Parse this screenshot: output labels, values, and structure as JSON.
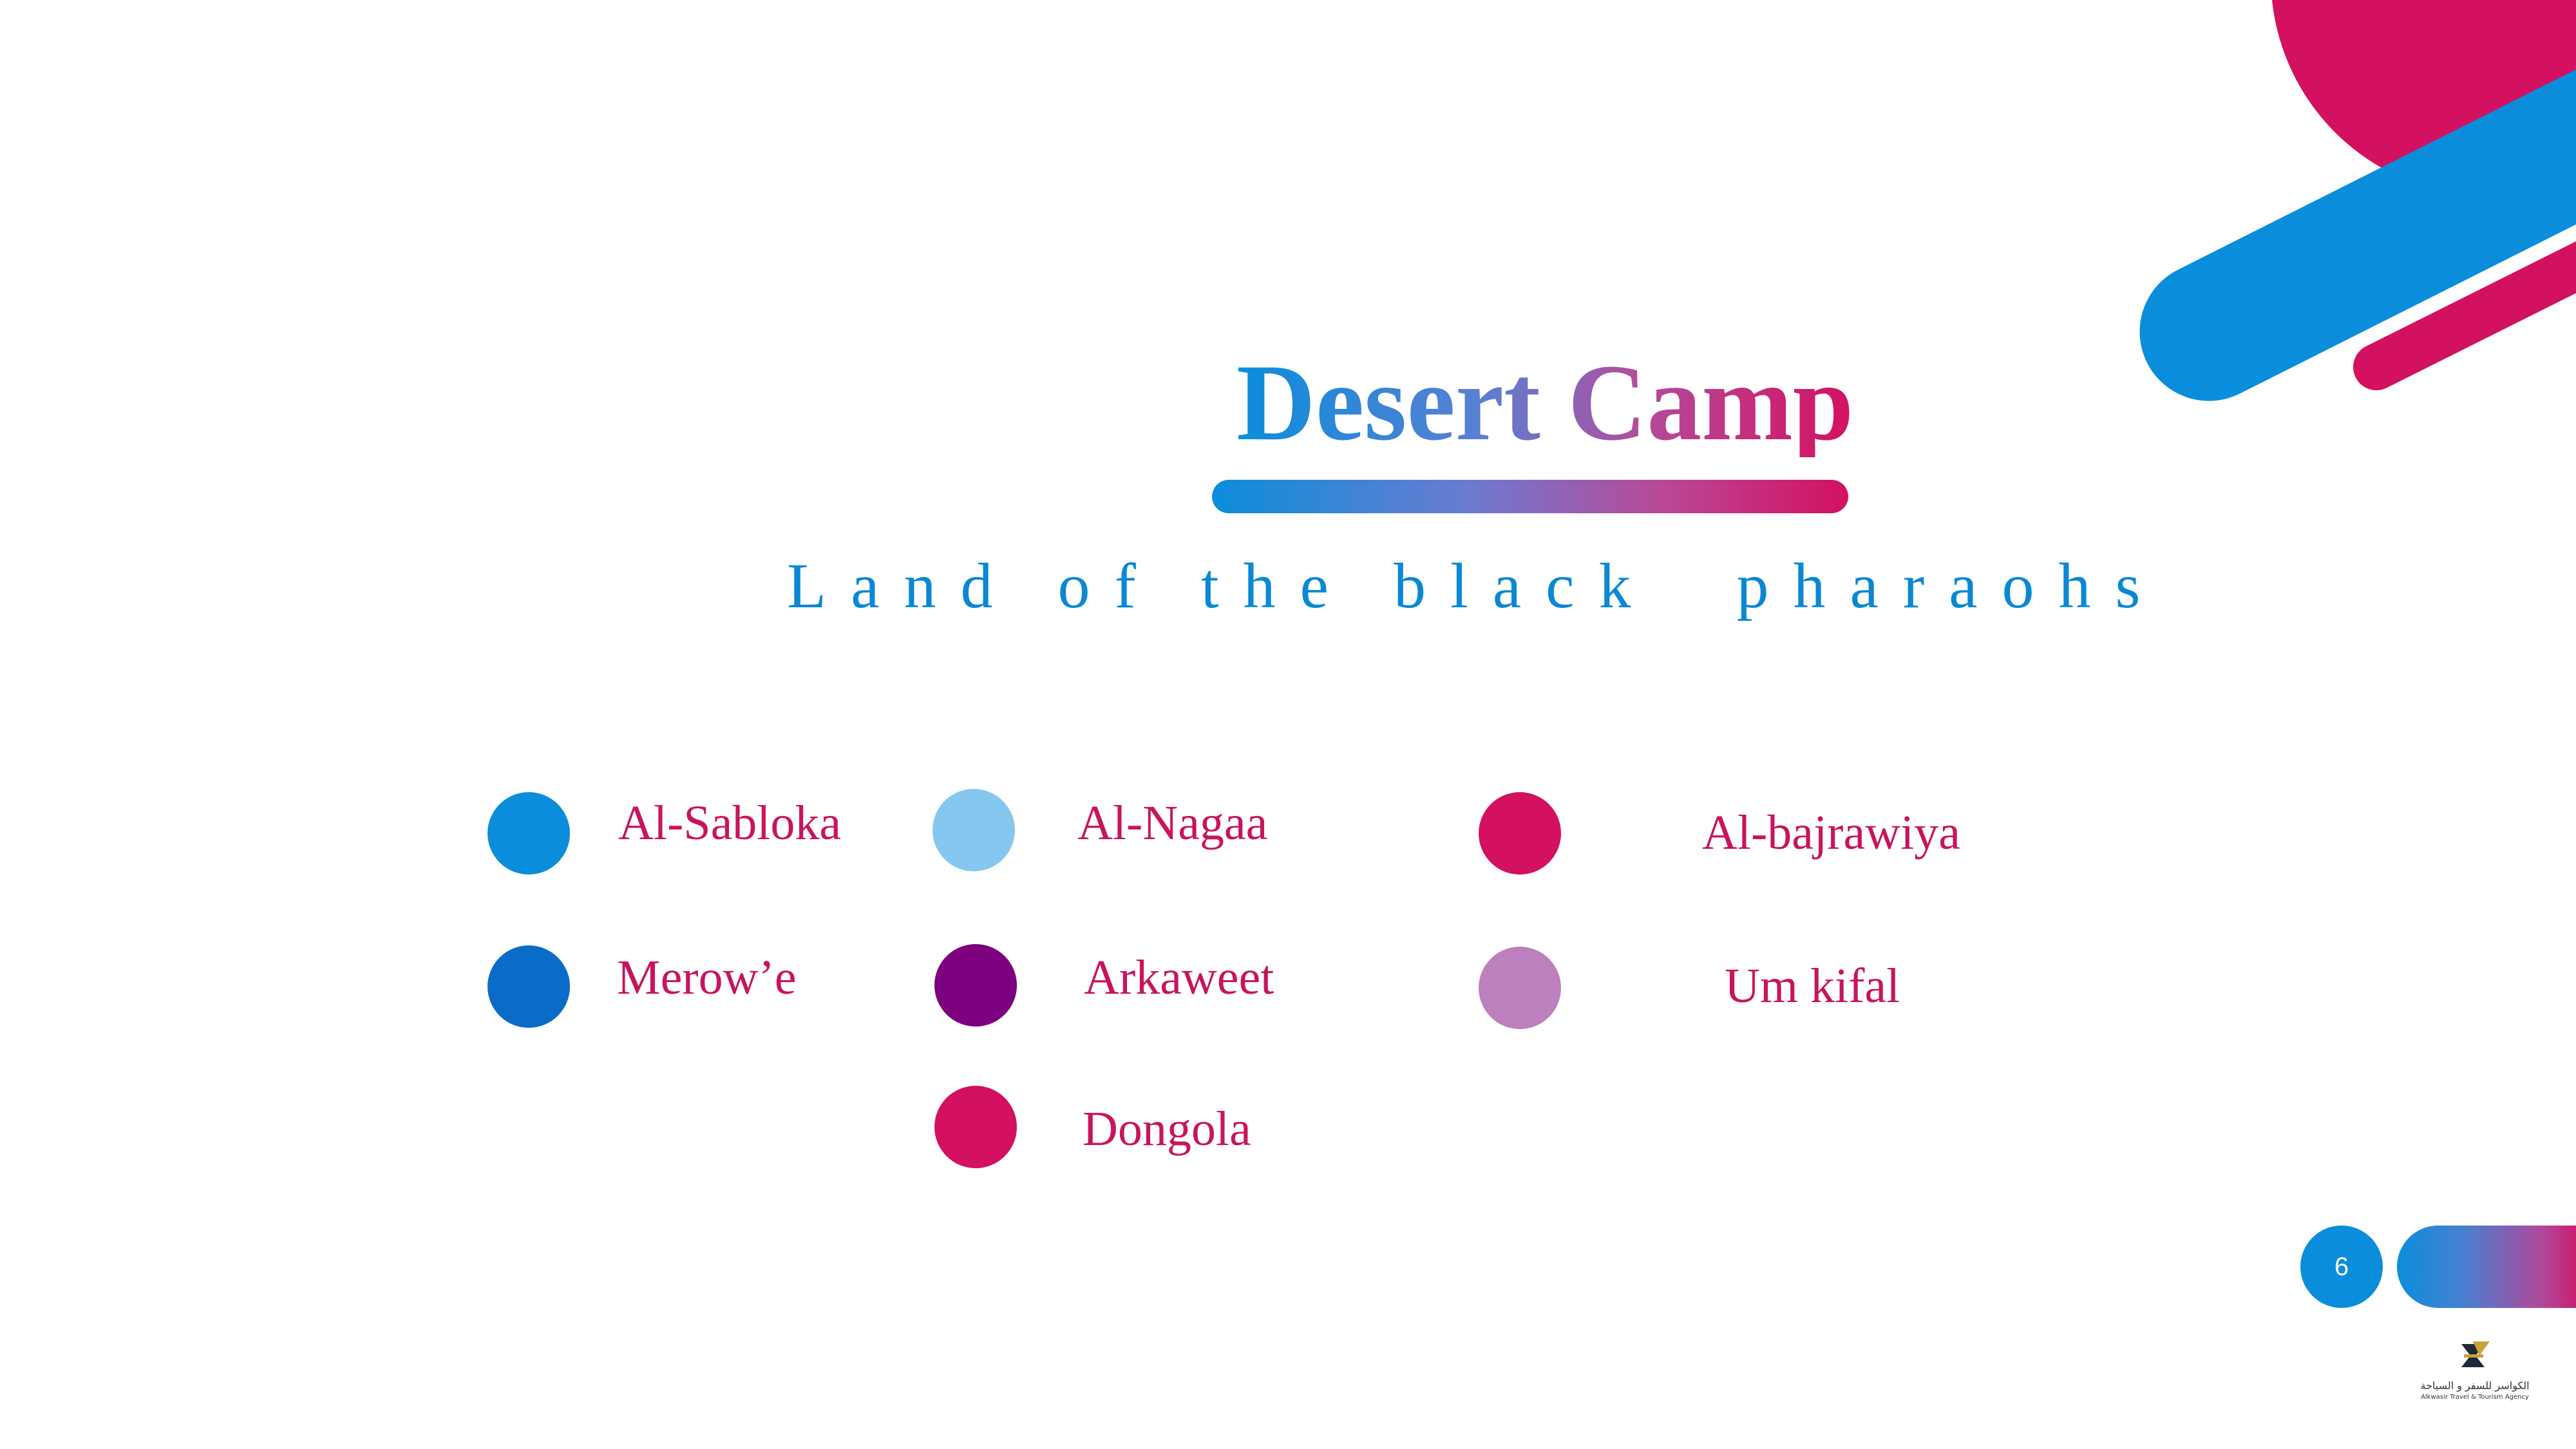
{
  "slide": {
    "title": "Desert Camp",
    "subtitle": "Land of the black  pharaohs",
    "page_number": "6"
  },
  "places": [
    {
      "label": "Al-Sabloka",
      "color": "#0a8edb"
    },
    {
      "label": "Al-Nagaa",
      "color": "#86c7ef"
    },
    {
      "label": "Al-bajrawiya",
      "color": "#d41060"
    },
    {
      "label": "Merow’e",
      "color": "#0a6cc9"
    },
    {
      "label": "Arkaweet",
      "color": "#7d007e"
    },
    {
      "label": "Um kifal",
      "color": "#bb80bd"
    },
    {
      "label": "Dongola",
      "color": "#d41060"
    }
  ],
  "logo": {
    "name_ar": "الكواسر للسفر و السياحة",
    "name_en": "Alkwasir Travel & Tourism Agency"
  },
  "colors": {
    "accent_blue": "#0a8edb",
    "accent_magenta": "#d41060",
    "label_text": "#c8145e"
  }
}
